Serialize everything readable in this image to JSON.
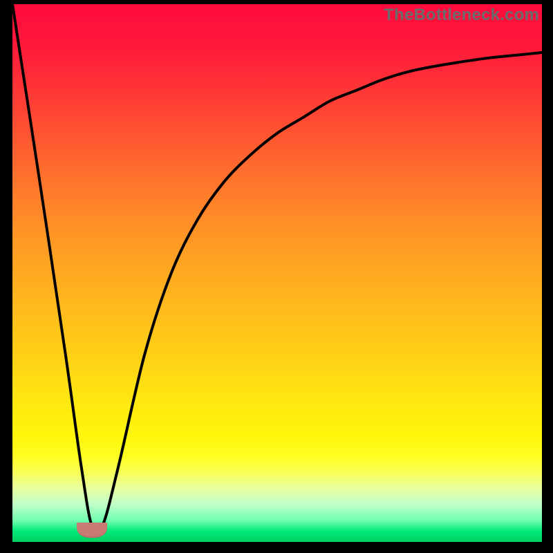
{
  "watermark": "TheBottleneck.com",
  "colors": {
    "curve_stroke": "#000000",
    "marker_fill": "#c97a73"
  },
  "chart_data": {
    "type": "line",
    "title": "",
    "xlabel": "",
    "ylabel": "",
    "xlim": [
      0,
      100
    ],
    "ylim": [
      0,
      100
    ],
    "grid": false,
    "legend": false,
    "series": [
      {
        "name": "bottleneck-curve",
        "x": [
          0,
          5,
          10,
          13,
          15,
          17,
          20,
          25,
          30,
          35,
          40,
          45,
          50,
          55,
          60,
          65,
          70,
          75,
          80,
          85,
          90,
          95,
          100
        ],
        "values": [
          100,
          68,
          35,
          14,
          3,
          3,
          14,
          35,
          50,
          60,
          67,
          72,
          76,
          79,
          82,
          84,
          86,
          87.5,
          88.5,
          89.3,
          90,
          90.5,
          91
        ]
      }
    ],
    "optimal_marker_x": 15
  }
}
